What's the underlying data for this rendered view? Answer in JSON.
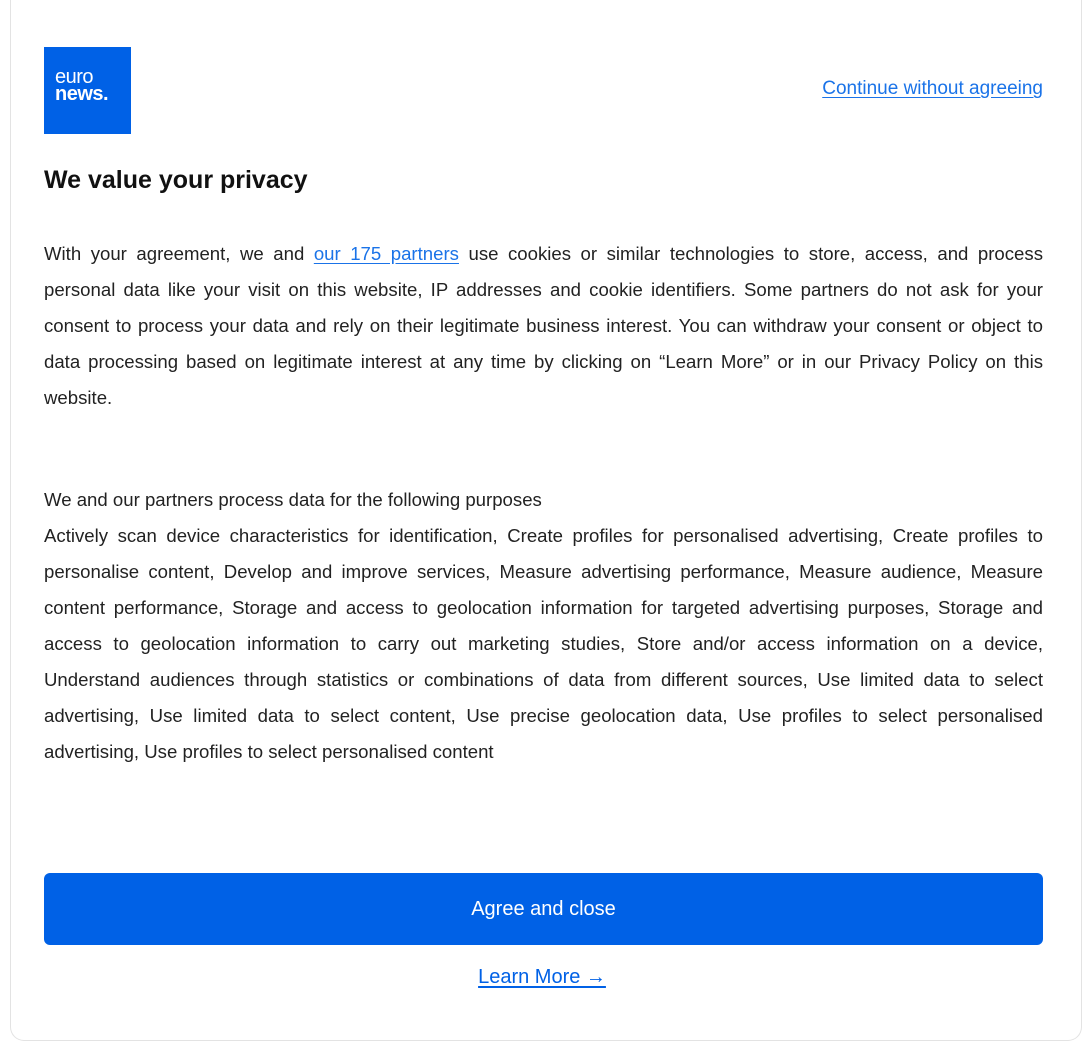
{
  "logo": {
    "line1": "euro",
    "line2": "news.",
    "color": "#0061e6"
  },
  "header": {
    "continue_link": "Continue without agreeing"
  },
  "title": "We value your privacy",
  "intro": {
    "before_link": "With your agreement, we and ",
    "partners_link": "our 175 partners",
    "after_link": " use cookies or similar technologies to store, access, and process personal data like your visit on this website, IP addresses and cookie identifiers. Some partners do not ask for your consent to process your data and rely on their legitimate business interest. You can withdraw your consent or object to data processing based on legitimate interest at any time by clicking on “Learn More” or in our Privacy Policy on this website."
  },
  "purposes": {
    "heading": "We and our partners process data for the following purposes",
    "list": "Actively scan device characteristics for identification, Create profiles for personalised advertising, Create profiles to personalise content, Develop and improve services, Measure advertising performance, Measure audience, Measure content performance, Storage and access to geolocation information for targeted advertising purposes, Storage and access to geolocation information to carry out marketing studies, Store and/or access information on a device, Understand audiences through statistics or combinations of data from different sources, Use limited data to select advertising, Use limited data to select content, Use precise geolocation data, Use profiles to select personalised advertising, Use profiles to select personalised content"
  },
  "actions": {
    "agree_label": "Agree and close",
    "learn_more_label": "Learn More →"
  },
  "colors": {
    "accent": "#0061e6",
    "link": "#1a73e8"
  }
}
